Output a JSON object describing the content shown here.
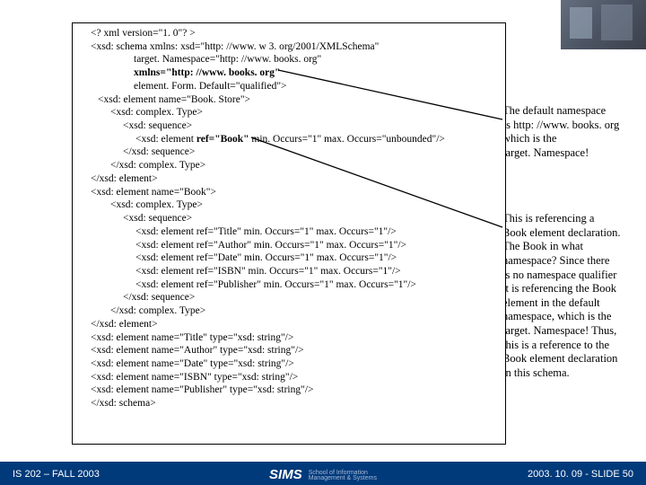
{
  "code": {
    "l1": "<? xml version=\"1. 0\"? >",
    "l2": "<xsd: schema xmlns: xsd=\"http: //www. w 3. org/2001/XMLSchema\"",
    "l3": "target. Namespace=\"http: //www. books. org\"",
    "l4": "xmlns=\"http: //www. books. org\"",
    "l5": "element. Form. Default=\"qualified\">",
    "l6": "<xsd: element name=\"Book. Store\">",
    "l7": "<xsd: complex. Type>",
    "l8": "<xsd: sequence>",
    "l9a": "<xsd: element ",
    "l9b": "ref=\"Book\" ",
    "l9c": "min. Occurs=\"1\" max. Occurs=\"unbounded\"/>",
    "l10": "</xsd: sequence>",
    "l11": "</xsd: complex. Type>",
    "l12": "</xsd: element>",
    "l13": "<xsd: element name=\"Book\">",
    "l14": "<xsd: complex. Type>",
    "l15": "<xsd: sequence>",
    "l16": "<xsd: element ref=\"Title\" min. Occurs=\"1\" max. Occurs=\"1\"/>",
    "l17": "<xsd: element ref=\"Author\" min. Occurs=\"1\" max. Occurs=\"1\"/>",
    "l18": "<xsd: element ref=\"Date\" min. Occurs=\"1\" max. Occurs=\"1\"/>",
    "l19": "<xsd: element ref=\"ISBN\" min. Occurs=\"1\" max. Occurs=\"1\"/>",
    "l20": "<xsd: element ref=\"Publisher\" min. Occurs=\"1\" max. Occurs=\"1\"/>",
    "l21": "</xsd: sequence>",
    "l22": "</xsd: complex. Type>",
    "l23": "</xsd: element>",
    "l24": "<xsd: element name=\"Title\" type=\"xsd: string\"/>",
    "l25": "<xsd: element name=\"Author\" type=\"xsd: string\"/>",
    "l26": "<xsd: element name=\"Date\" type=\"xsd: string\"/>",
    "l27": "<xsd: element name=\"ISBN\" type=\"xsd: string\"/>",
    "l28": "<xsd: element name=\"Publisher\" type=\"xsd: string\"/>",
    "l29": "</xsd: schema>"
  },
  "notes": {
    "n1": "The default namespace\n Is http: //www. books. org\n which is the\n target. Namespace!",
    "n2": "This is referencing a\nBook element declaration.\nThe Book in what\nnamespace?  Since there\nis no namespace qualifier\nit is referencing the Book\nelement in the default\nnamespace, which is the\ntarget. Namespace!  Thus,\nthis is a reference to the\nBook element declaration\nin this schema."
  },
  "footer": {
    "left": "IS 202 – FALL 2003",
    "right": "2003. 10. 09 - SLIDE 50",
    "sims": "SIMS",
    "sims_sub1": "School of Information",
    "sims_sub2": "Management & Systems"
  }
}
